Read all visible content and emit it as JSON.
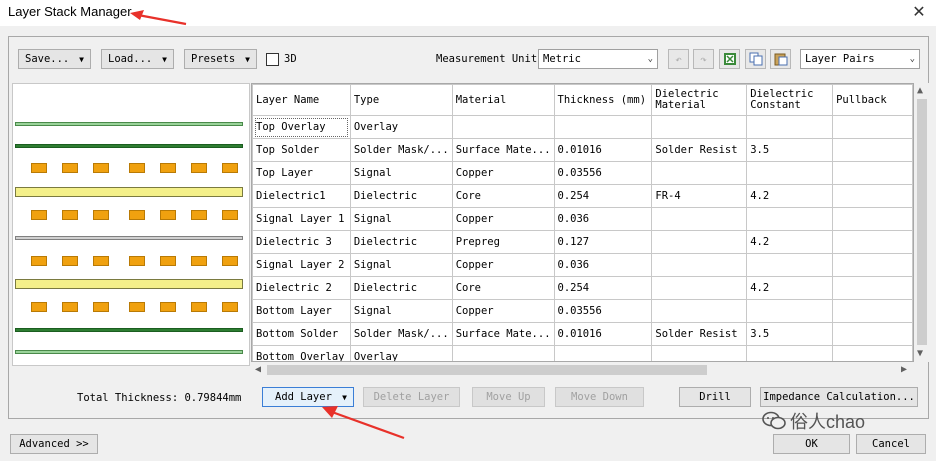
{
  "window": {
    "title": "Layer Stack Manager"
  },
  "toolbar": {
    "save_label": "Save...",
    "load_label": "Load...",
    "presets_label": "Presets",
    "checkbox_3d_label": "3D",
    "measurement_unit_label": "Measurement Unit",
    "measurement_unit_value": "Metric",
    "layer_pairs_value": "Layer Pairs"
  },
  "table": {
    "headers": [
      "Layer Name",
      "Type",
      "Material",
      "Thickness (mm)",
      "Dielectric Material",
      "Dielectric Constant",
      "Pullback"
    ],
    "rows": [
      [
        "Top Overlay",
        "Overlay",
        "",
        "",
        "",
        "",
        ""
      ],
      [
        "Top Solder",
        "Solder Mask/...",
        "Surface Mate...",
        "0.01016",
        "Solder Resist",
        "3.5",
        ""
      ],
      [
        "Top Layer",
        "Signal",
        "Copper",
        "0.03556",
        "",
        "",
        ""
      ],
      [
        "Dielectric1",
        "Dielectric",
        "Core",
        "0.254",
        "FR-4",
        "4.2",
        ""
      ],
      [
        "Signal Layer 1",
        "Signal",
        "Copper",
        "0.036",
        "",
        "",
        ""
      ],
      [
        "Dielectric 3",
        "Dielectric",
        "Prepreg",
        "0.127",
        "",
        "4.2",
        ""
      ],
      [
        "Signal Layer 2",
        "Signal",
        "Copper",
        "0.036",
        "",
        "",
        ""
      ],
      [
        "Dielectric 2",
        "Dielectric",
        "Core",
        "0.254",
        "",
        "4.2",
        ""
      ],
      [
        "Bottom Layer",
        "Signal",
        "Copper",
        "0.03556",
        "",
        "",
        ""
      ],
      [
        "Bottom Solder",
        "Solder Mask/...",
        "Surface Mate...",
        "0.01016",
        "Solder Resist",
        "3.5",
        ""
      ],
      [
        "Bottom Overlay",
        "Overlay",
        "",
        "",
        "",
        "",
        ""
      ]
    ]
  },
  "footer": {
    "total_thickness": "Total Thickness: 0.79844mm",
    "add_layer_label": "Add Layer",
    "delete_layer_label": "Delete Layer",
    "move_up_label": "Move Up",
    "move_down_label": "Move Down",
    "drill_label": "Drill",
    "impedance_label": "Impedance Calculation...",
    "advanced_label": "Advanced >>",
    "ok_label": "OK",
    "cancel_label": "Cancel"
  },
  "watermark": {
    "text": "俗人chao"
  },
  "colors": {
    "overlay_layer": "#9ad39a",
    "solder_layer": "#2e7d32",
    "copper_pad": "#f0a10f",
    "core_dielectric": "#f4f08a",
    "prepreg_dielectric": "#b0b0b0",
    "annotation_arrow": "#e8312a"
  }
}
